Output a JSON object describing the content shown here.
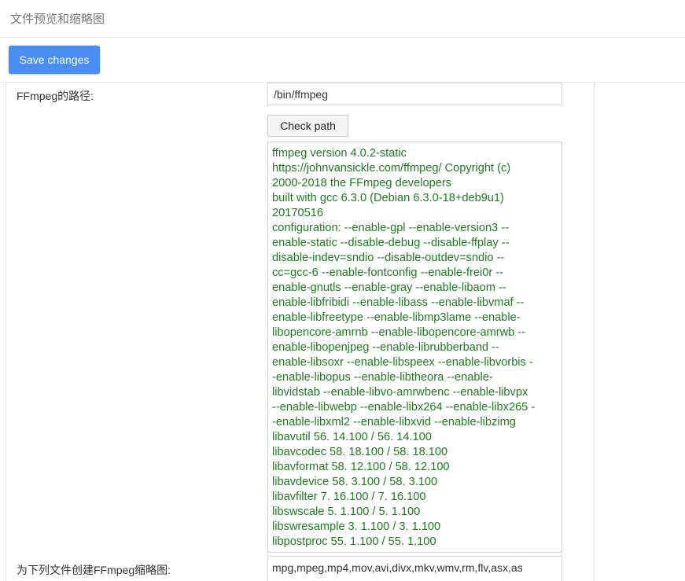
{
  "header": {
    "title": "文件预览和缩略图"
  },
  "toolbar": {
    "save_label": "Save changes"
  },
  "ffmpeg_path": {
    "label": "FFmpeg的路径:",
    "value": "/bin/ffmpeg",
    "check_label": "Check path"
  },
  "ffmpeg_output": {
    "lines": [
      "ffmpeg version 4.0.2-static",
      "https://johnvansickle.com/ffmpeg/ Copyright (c)",
      "2000-2018 the FFmpeg developers",
      "built with gcc 6.3.0 (Debian 6.3.0-18+deb9u1)",
      "20170516",
      "configuration: --enable-gpl --enable-version3 --",
      "enable-static --disable-debug --disable-ffplay --",
      "disable-indev=sndio --disable-outdev=sndio --",
      "cc=gcc-6 --enable-fontconfig --enable-frei0r --",
      "enable-gnutls --enable-gray --enable-libaom --",
      "enable-libfribidi --enable-libass --enable-libvmaf --",
      "enable-libfreetype --enable-libmp3lame --enable-",
      "libopencore-amrnb --enable-libopencore-amrwb --",
      "enable-libopenjpeg --enable-librubberband --",
      "enable-libsoxr --enable-libspeex --enable-libvorbis -",
      "-enable-libopus --enable-libtheora --enable-",
      "libvidstab --enable-libvo-amrwbenc --enable-libvpx",
      "--enable-libwebp --enable-libx264 --enable-libx265 -",
      "-enable-libxml2 --enable-libxvid --enable-libzimg",
      "libavutil 56. 14.100 / 56. 14.100",
      "libavcodec 58. 18.100 / 58. 18.100",
      "libavformat 58. 12.100 / 58. 12.100",
      "libavdevice 58. 3.100 / 58. 3.100",
      "libavfilter 7. 16.100 / 7. 16.100",
      "libswscale 5. 1.100 / 5. 1.100",
      "libswresample 3. 1.100 / 3. 1.100",
      "libpostproc 55. 1.100 / 55. 1.100"
    ]
  },
  "thumbnail_types": {
    "label": "为下列文件创建FFmpeg缩略图:",
    "value": "mpg,mpeg,mp4,mov,avi,divx,mkv,wmv,rm,flv,asx,as"
  },
  "colors": {
    "accent": "#4a8ef5",
    "output_text": "#1f7a1f"
  }
}
